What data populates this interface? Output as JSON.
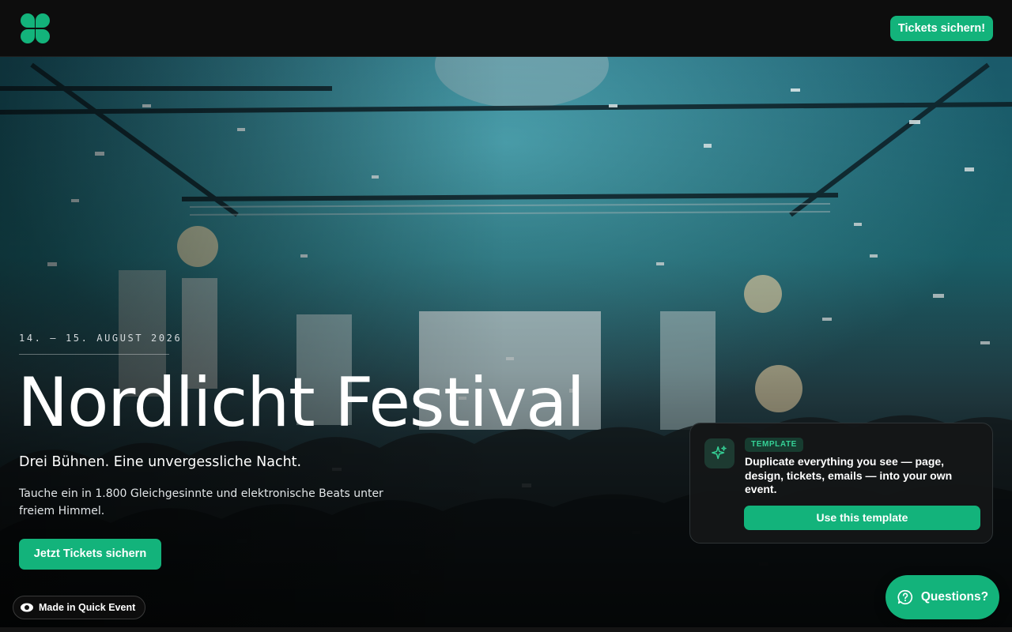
{
  "header": {
    "logo_icon": "four-leaf-clover-icon",
    "cta_label": "Tickets sichern!"
  },
  "hero": {
    "date": "14. – 15. AUGUST 2026",
    "title": "Nordlicht Festival",
    "subtitle": "Drei Bühnen. Eine unvergessliche Nacht.",
    "description": "Tauche ein in 1.800 Gleichgesinnte und elektronische Beats unter freiem Himmel.",
    "cta_label": "Jetzt Tickets sichern"
  },
  "made_badge": {
    "label": "Made in Quick Event",
    "icon": "eye-icon"
  },
  "template_card": {
    "icon": "sparkles-icon",
    "badge": "TEMPLATE",
    "text": "Duplicate everything you see — page, design, tickets, emails — into your own event.",
    "button_label": "Use this template"
  },
  "help": {
    "label": "Questions?",
    "icon": "question-bubble-icon"
  },
  "colors": {
    "accent": "#13b37b",
    "header_bg": "#0d0d0d",
    "card_bg": "#141617"
  }
}
